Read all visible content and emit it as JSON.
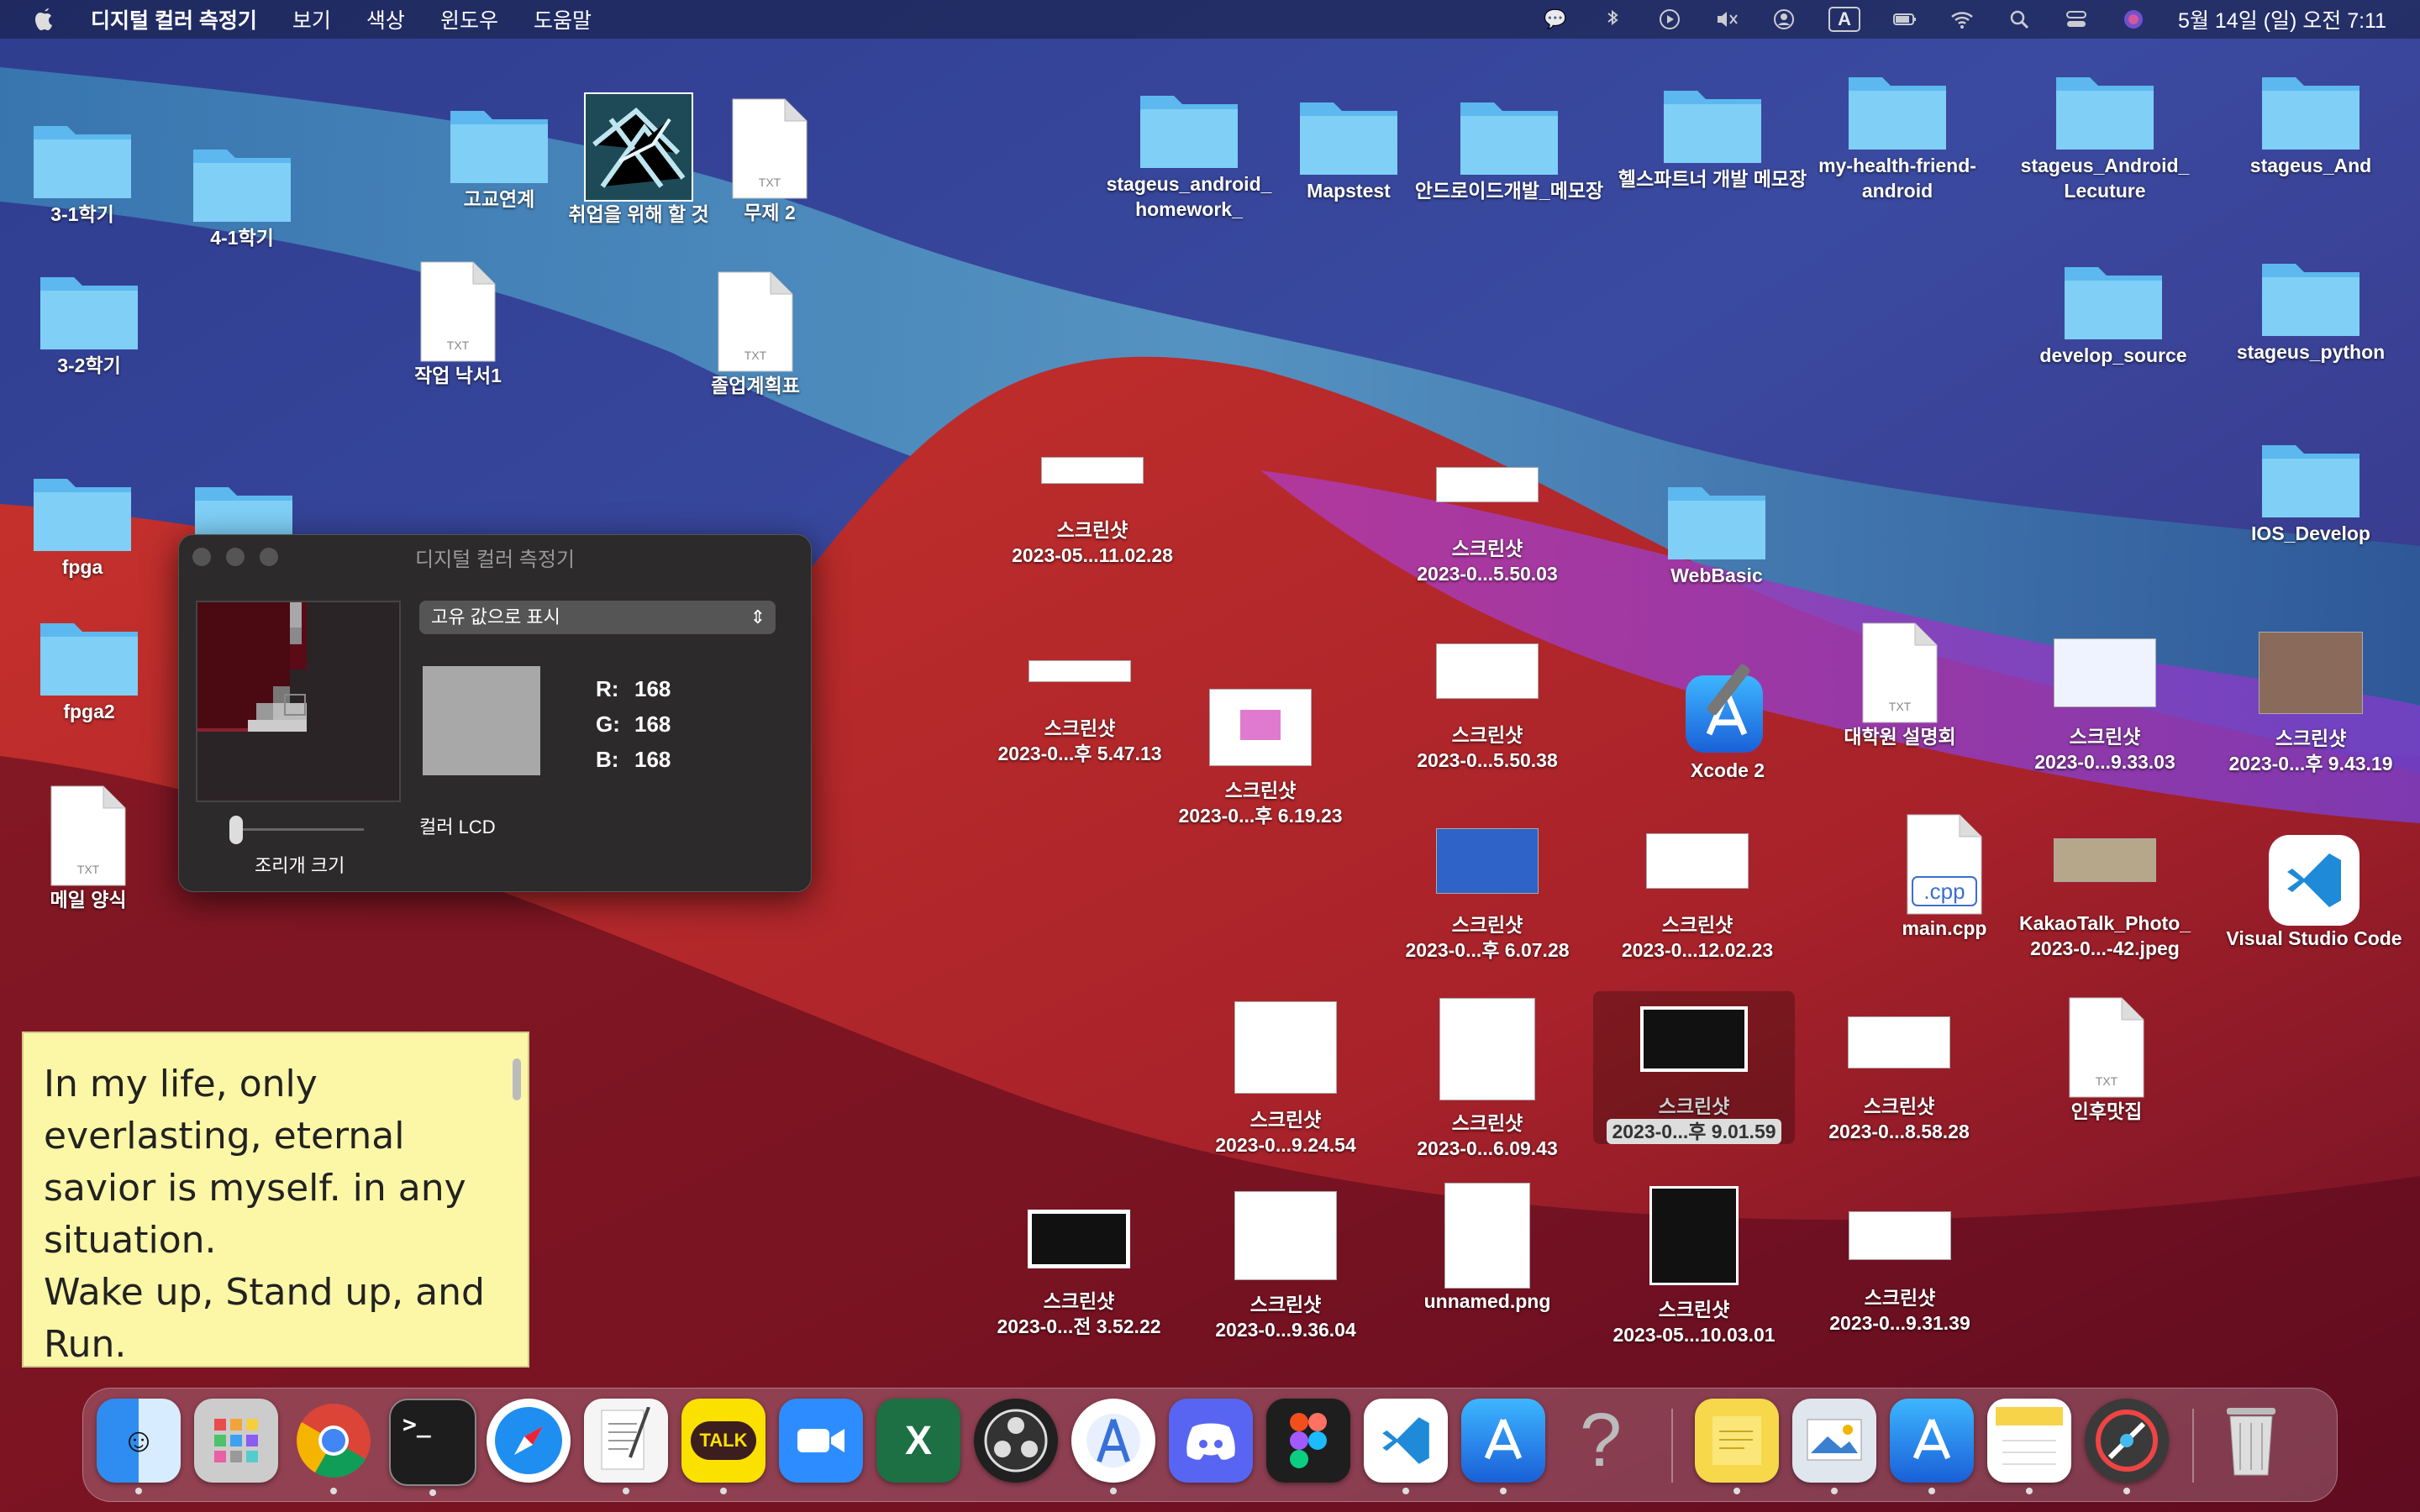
{
  "menubar": {
    "app_name": "디지털 컬러 측정기",
    "menus": [
      "보기",
      "색상",
      "윈도우",
      "도움말"
    ],
    "status_icons": [
      "message-icon",
      "bluetooth-icon",
      "play-icon",
      "mute-icon",
      "user-icon",
      "input-source-icon",
      "battery-icon",
      "wifi-icon",
      "search-icon",
      "control-center-icon",
      "siri-icon"
    ],
    "input_source": "A",
    "clock": "5월 14일 (일) 오전 7:11"
  },
  "desktop": {
    "folders": [
      {
        "label": "3-1학기"
      },
      {
        "label": "4-1학기"
      },
      {
        "label": "3-2학기"
      },
      {
        "label": "fpga"
      },
      {
        "label": "fpga2"
      },
      {
        "label": "고교연계"
      },
      {
        "label": "stageus_android_",
        "label2": "homework_"
      },
      {
        "label": "Mapstest"
      },
      {
        "label": "안드로이드개발_메모장"
      },
      {
        "label": "헬스파트너 개발 메모장"
      },
      {
        "label": "my-health-friend-",
        "label2": "android"
      },
      {
        "label": "stageus_Android_",
        "label2": "Lecuture"
      },
      {
        "label": "stageus_And"
      },
      {
        "label": "develop_source"
      },
      {
        "label": "stageus_python"
      },
      {
        "label": "IOS_Develop"
      },
      {
        "label": "WebBasic"
      }
    ],
    "files": [
      {
        "label": "취업을 위해 할 것"
      },
      {
        "label": "무제 2"
      },
      {
        "label": "작업 낙서1"
      },
      {
        "label": "졸업계획표"
      },
      {
        "label": "메일 양식"
      },
      {
        "label": "대학원 설명회"
      },
      {
        "label": "main.cpp"
      },
      {
        "label": "인후맛집"
      },
      {
        "label": "Xcode 2"
      },
      {
        "label": "Visual Studio Code"
      },
      {
        "label": "unnamed.png"
      }
    ],
    "screenshots": [
      {
        "l1": "스크린샷",
        "l2": "2023-05...11.02.28"
      },
      {
        "l1": "스크린샷",
        "l2": "2023-0...5.50.03"
      },
      {
        "l1": "스크린샷",
        "l2": "2023-0...후 5.47.13"
      },
      {
        "l1": "스크린샷",
        "l2": "2023-0...후 6.19.23"
      },
      {
        "l1": "스크린샷",
        "l2": "2023-0...5.50.38"
      },
      {
        "l1": "스크린샷",
        "l2": "2023-0...9.33.03"
      },
      {
        "l1": "스크린샷",
        "l2": "2023-0...후 9.43.19"
      },
      {
        "l1": "스크린샷",
        "l2": "2023-0...후 6.07.28"
      },
      {
        "l1": "스크린샷",
        "l2": "2023-0...12.02.23"
      },
      {
        "l1": "KakaoTalk_Photo_",
        "l2": "2023-0...-42.jpeg"
      },
      {
        "l1": "스크린샷",
        "l2": "2023-0...9.24.54"
      },
      {
        "l1": "스크린샷",
        "l2": "2023-0...6.09.43"
      },
      {
        "l1": "스크린샷",
        "l2": "2023-0...후 9.01.59"
      },
      {
        "l1": "스크린샷",
        "l2": "2023-0...8.58.28"
      },
      {
        "l1": "스크린샷",
        "l2": "2023-0...전 3.52.22"
      },
      {
        "l1": "스크린샷",
        "l2": "2023-0...9.36.04"
      },
      {
        "l1": "스크린샷",
        "l2": "2023-05...10.03.01"
      },
      {
        "l1": "스크린샷",
        "l2": "2023-0...9.31.39"
      }
    ]
  },
  "color_picker": {
    "title": "디지털 컬러 측정기",
    "display_mode": "고유 값으로 표시",
    "r_label": "R:",
    "r": "168",
    "g_label": "G:",
    "g": "168",
    "b_label": "B:",
    "b": "168",
    "profile": "컬러 LCD",
    "aperture_label": "조리개 크기",
    "swatch_color": "#a8a8a8"
  },
  "sticky_note": {
    "text": "In my life, only everlasting, eternal savior is myself. in any situation.\nWake up, Stand up, and Run."
  },
  "dock": {
    "apps": [
      "finder-icon",
      "launchpad-icon",
      "chrome-icon",
      "terminal-icon",
      "safari-icon",
      "textedit-icon",
      "kakaotalk-icon",
      "zoom-icon",
      "excel-icon",
      "obs-icon",
      "android-studio-icon",
      "discord-icon",
      "figma-icon",
      "vscode-icon",
      "xcode-icon",
      "unknown-app-icon",
      "stickies-icon",
      "preview-icon",
      "xcode-build-icon",
      "notes-icon",
      "digital-color-meter-icon",
      "trash-icon"
    ],
    "kakao_label": "TALK"
  }
}
